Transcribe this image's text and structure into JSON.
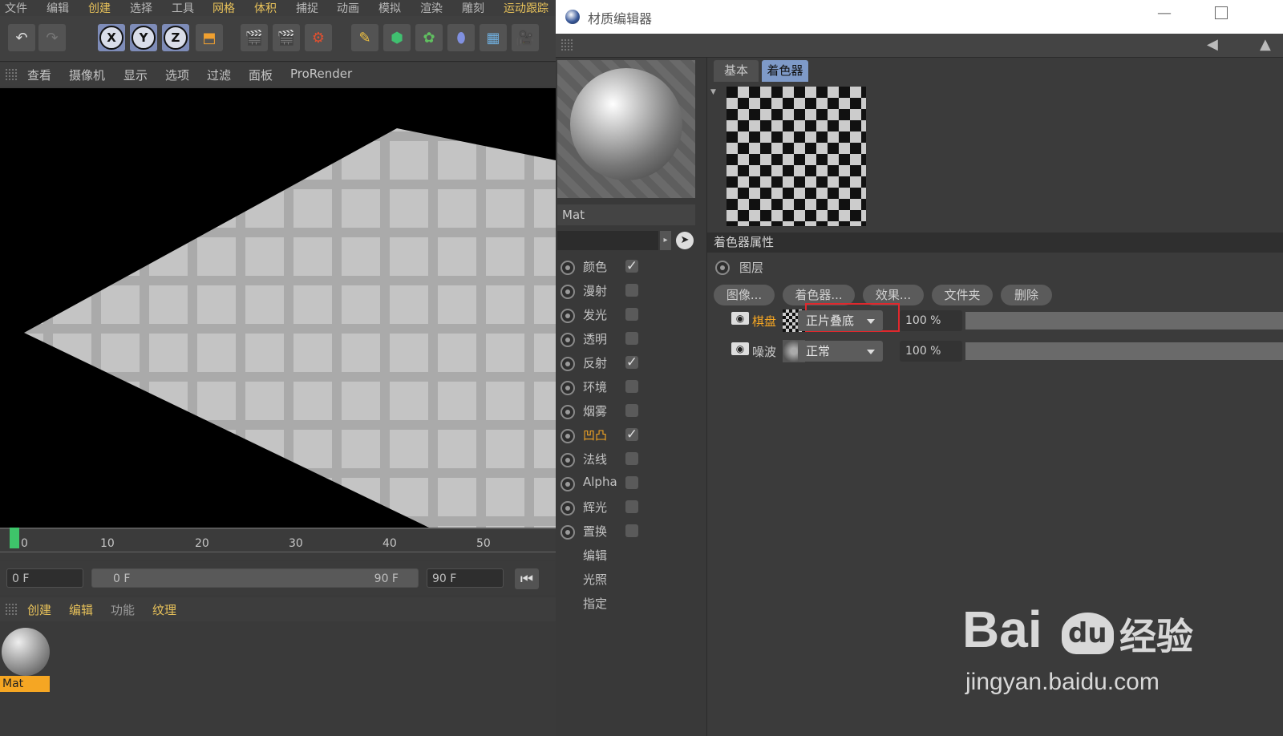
{
  "main_menu": [
    "文件",
    "编辑",
    "创建",
    "选择",
    "工具",
    "网格",
    "体积",
    "捕捉",
    "动画",
    "模拟",
    "渲染",
    "雕刻",
    "运动跟踪"
  ],
  "viewport_menu": [
    "查看",
    "摄像机",
    "显示",
    "选项",
    "过滤",
    "面板",
    "ProRender"
  ],
  "toolbar": {
    "x_label": "X",
    "y_label": "Y",
    "z_label": "Z"
  },
  "timeline": {
    "ticks": [
      "0",
      "10",
      "20",
      "30",
      "40",
      "50"
    ]
  },
  "frames": {
    "start": "0 F",
    "range_start": "0 F",
    "range_end": "90 F",
    "end": "90 F"
  },
  "material_menu": [
    "创建",
    "编辑",
    "功能",
    "纹理"
  ],
  "material_bin": {
    "item_label": "Mat"
  },
  "editor": {
    "title": "材质编辑器",
    "material_name": "Mat",
    "channels": [
      {
        "label": "颜色",
        "checked": true,
        "active": false
      },
      {
        "label": "漫射",
        "checked": false,
        "active": false
      },
      {
        "label": "发光",
        "checked": false,
        "active": false
      },
      {
        "label": "透明",
        "checked": false,
        "active": false
      },
      {
        "label": "反射",
        "checked": true,
        "active": false
      },
      {
        "label": "环境",
        "checked": false,
        "active": false
      },
      {
        "label": "烟雾",
        "checked": false,
        "active": false
      },
      {
        "label": "凹凸",
        "checked": true,
        "active": true
      },
      {
        "label": "法线",
        "checked": false,
        "active": false
      },
      {
        "label": "Alpha",
        "checked": false,
        "active": false
      },
      {
        "label": "辉光",
        "checked": false,
        "active": false
      },
      {
        "label": "置换",
        "checked": false,
        "active": false
      }
    ],
    "extra": [
      "编辑",
      "光照",
      "指定"
    ],
    "tabs": {
      "basic": "基本",
      "shader": "着色器"
    },
    "section_title": "着色器属性",
    "layer_label": "图层",
    "buttons": [
      "图像...",
      "着色器...",
      "效果...",
      "文件夹",
      "删除"
    ],
    "layers": [
      {
        "name": "棋盘",
        "blend": "正片叠底",
        "opacity": "100 %"
      },
      {
        "name": "噪波",
        "blend": "正常",
        "opacity": "100 %"
      }
    ]
  },
  "watermark": {
    "brand_a": "Bai",
    "brand_b": "du",
    "suffix": "经验",
    "url": "jingyan.baidu.com"
  }
}
